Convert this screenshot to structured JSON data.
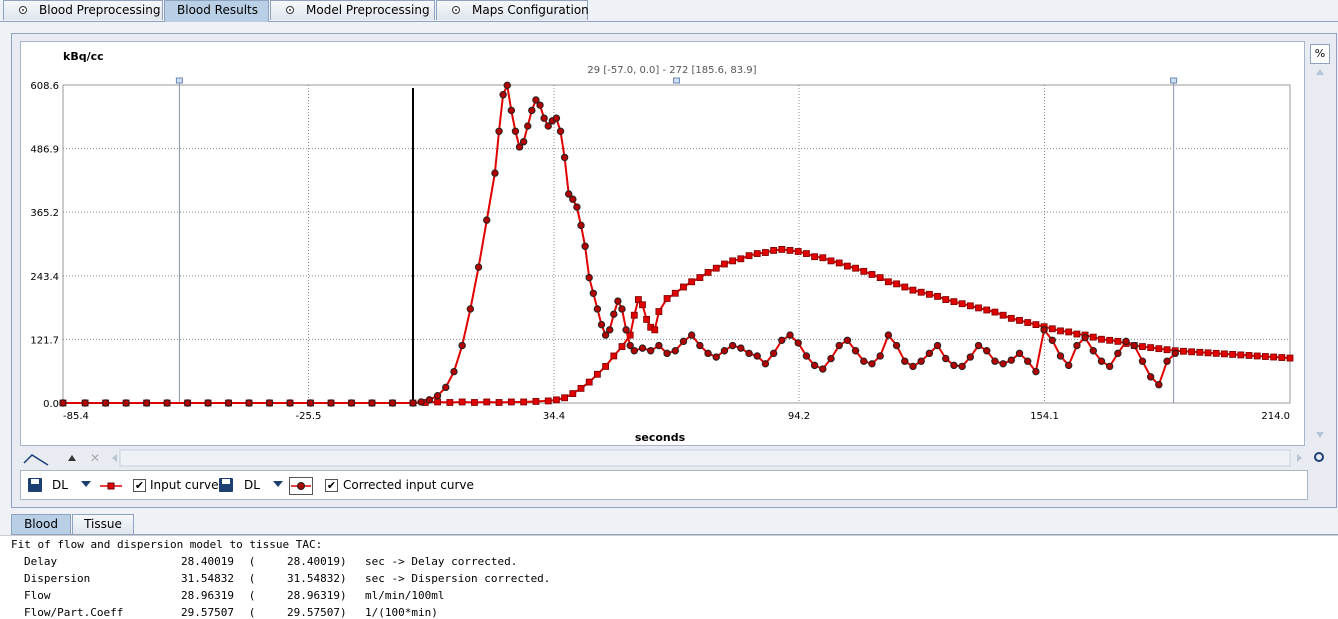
{
  "tabs": [
    {
      "label": "Blood Preprocessing",
      "active": false
    },
    {
      "label": "Blood Results",
      "active": true
    },
    {
      "label": "Model Preprocessing",
      "active": false
    },
    {
      "label": "Maps Configuration",
      "active": false
    }
  ],
  "plot": {
    "y_unit": "kBq/cc",
    "x_label": "seconds",
    "range_readout": "29 [-57.0, 0.0] - 272 [185.6, 83.9]",
    "percent_button": "%"
  },
  "chart_data": {
    "type": "line",
    "xlabel": "seconds",
    "ylabel": "kBq/cc",
    "xlim": [
      -85.4,
      214.0
    ],
    "ylim": [
      0.0,
      608.6
    ],
    "x_ticks": [
      "-85.4",
      "-25.5",
      "34.4",
      "94.2",
      "154.1",
      "214.0"
    ],
    "y_ticks": [
      "608.6",
      "486.9",
      "365.2",
      "243.4",
      "121.7",
      "0.0"
    ],
    "grid": true,
    "markers_x": [
      -57.0,
      185.6
    ],
    "delay_line_x": 0.0,
    "series": [
      {
        "name": "Input curve",
        "color": "#e00000",
        "marker": "square",
        "points": [
          [
            -85.4,
            0
          ],
          [
            -80,
            0
          ],
          [
            -75,
            0
          ],
          [
            -70,
            0
          ],
          [
            -65,
            0
          ],
          [
            -60,
            0
          ],
          [
            -55,
            0
          ],
          [
            -50,
            0
          ],
          [
            -45,
            0
          ],
          [
            -40,
            0
          ],
          [
            -35,
            0
          ],
          [
            -30,
            0
          ],
          [
            -25,
            0
          ],
          [
            -20,
            0
          ],
          [
            -15,
            0
          ],
          [
            -10,
            0
          ],
          [
            -5,
            0
          ],
          [
            0,
            0
          ],
          [
            3,
            1
          ],
          [
            6,
            2
          ],
          [
            9,
            1
          ],
          [
            12,
            2
          ],
          [
            15,
            1
          ],
          [
            18,
            2
          ],
          [
            21,
            1
          ],
          [
            24,
            2
          ],
          [
            27,
            2
          ],
          [
            30,
            3
          ],
          [
            33,
            4
          ],
          [
            35,
            6
          ],
          [
            37,
            10
          ],
          [
            39,
            18
          ],
          [
            41,
            28
          ],
          [
            43,
            40
          ],
          [
            45,
            55
          ],
          [
            47,
            70
          ],
          [
            49,
            90
          ],
          [
            51,
            108
          ],
          [
            53,
            130
          ],
          [
            54,
            168
          ],
          [
            55,
            198
          ],
          [
            56,
            188
          ],
          [
            57,
            160
          ],
          [
            58,
            145
          ],
          [
            59,
            140
          ],
          [
            60,
            175
          ],
          [
            62,
            200
          ],
          [
            64,
            210
          ],
          [
            66,
            222
          ],
          [
            68,
            232
          ],
          [
            70,
            240
          ],
          [
            72,
            250
          ],
          [
            74,
            258
          ],
          [
            76,
            266
          ],
          [
            78,
            272
          ],
          [
            80,
            276
          ],
          [
            82,
            282
          ],
          [
            84,
            286
          ],
          [
            86,
            288
          ],
          [
            88,
            292
          ],
          [
            90,
            294
          ],
          [
            92,
            292
          ],
          [
            94,
            290
          ],
          [
            96,
            286
          ],
          [
            98,
            280
          ],
          [
            100,
            278
          ],
          [
            102,
            272
          ],
          [
            104,
            268
          ],
          [
            106,
            262
          ],
          [
            108,
            258
          ],
          [
            110,
            252
          ],
          [
            112,
            246
          ],
          [
            114,
            240
          ],
          [
            116,
            232
          ],
          [
            118,
            228
          ],
          [
            120,
            222
          ],
          [
            122,
            216
          ],
          [
            124,
            212
          ],
          [
            126,
            208
          ],
          [
            128,
            204
          ],
          [
            130,
            198
          ],
          [
            132,
            194
          ],
          [
            134,
            190
          ],
          [
            136,
            186
          ],
          [
            138,
            182
          ],
          [
            140,
            178
          ],
          [
            142,
            174
          ],
          [
            144,
            168
          ],
          [
            146,
            162
          ],
          [
            148,
            158
          ],
          [
            150,
            154
          ],
          [
            152,
            150
          ],
          [
            154,
            146
          ],
          [
            156,
            142
          ],
          [
            158,
            138
          ],
          [
            160,
            136
          ],
          [
            162,
            132
          ],
          [
            164,
            130
          ],
          [
            166,
            126
          ],
          [
            168,
            122
          ],
          [
            170,
            120
          ],
          [
            172,
            118
          ],
          [
            174,
            114
          ],
          [
            176,
            110
          ],
          [
            178,
            108
          ],
          [
            180,
            106
          ],
          [
            182,
            104
          ],
          [
            184,
            102
          ],
          [
            186,
            100
          ],
          [
            188,
            99
          ],
          [
            190,
            98
          ],
          [
            192,
            97
          ],
          [
            194,
            96
          ],
          [
            196,
            95
          ],
          [
            198,
            94
          ],
          [
            200,
            93
          ],
          [
            202,
            92
          ],
          [
            204,
            91
          ],
          [
            206,
            90
          ],
          [
            208,
            89
          ],
          [
            210,
            88
          ],
          [
            212,
            87
          ],
          [
            214,
            86
          ]
        ]
      },
      {
        "name": "Corrected input curve",
        "color": "#e00000",
        "marker": "circle",
        "points": [
          [
            -85.4,
            0
          ],
          [
            -80,
            0
          ],
          [
            -75,
            0
          ],
          [
            -70,
            0
          ],
          [
            -65,
            0
          ],
          [
            -60,
            0
          ],
          [
            -55,
            0
          ],
          [
            -50,
            0
          ],
          [
            -45,
            0
          ],
          [
            -40,
            0
          ],
          [
            -35,
            0
          ],
          [
            -30,
            0
          ],
          [
            -25,
            0
          ],
          [
            -20,
            0
          ],
          [
            -15,
            0
          ],
          [
            -10,
            0
          ],
          [
            -5,
            0
          ],
          [
            0,
            0
          ],
          [
            2,
            2
          ],
          [
            4,
            6
          ],
          [
            6,
            14
          ],
          [
            8,
            30
          ],
          [
            10,
            60
          ],
          [
            12,
            110
          ],
          [
            14,
            180
          ],
          [
            16,
            260
          ],
          [
            18,
            350
          ],
          [
            20,
            440
          ],
          [
            21,
            520
          ],
          [
            22,
            590
          ],
          [
            23,
            608
          ],
          [
            24,
            560
          ],
          [
            25,
            520
          ],
          [
            26,
            490
          ],
          [
            27,
            500
          ],
          [
            28,
            530
          ],
          [
            29,
            560
          ],
          [
            30,
            580
          ],
          [
            31,
            570
          ],
          [
            32,
            545
          ],
          [
            33,
            530
          ],
          [
            34,
            540
          ],
          [
            35,
            545
          ],
          [
            36,
            520
          ],
          [
            37,
            470
          ],
          [
            38,
            400
          ],
          [
            39,
            390
          ],
          [
            40,
            375
          ],
          [
            41,
            340
          ],
          [
            42,
            300
          ],
          [
            43,
            240
          ],
          [
            44,
            210
          ],
          [
            45,
            180
          ],
          [
            46,
            150
          ],
          [
            47,
            130
          ],
          [
            48,
            140
          ],
          [
            49,
            170
          ],
          [
            50,
            195
          ],
          [
            51,
            180
          ],
          [
            52,
            140
          ],
          [
            53,
            110
          ],
          [
            54,
            100
          ],
          [
            56,
            105
          ],
          [
            58,
            100
          ],
          [
            60,
            110
          ],
          [
            62,
            95
          ],
          [
            64,
            100
          ],
          [
            66,
            118
          ],
          [
            68,
            130
          ],
          [
            70,
            110
          ],
          [
            72,
            95
          ],
          [
            74,
            88
          ],
          [
            76,
            100
          ],
          [
            78,
            110
          ],
          [
            80,
            105
          ],
          [
            82,
            95
          ],
          [
            84,
            90
          ],
          [
            86,
            75
          ],
          [
            88,
            95
          ],
          [
            90,
            120
          ],
          [
            92,
            130
          ],
          [
            94,
            115
          ],
          [
            96,
            90
          ],
          [
            98,
            72
          ],
          [
            100,
            65
          ],
          [
            102,
            85
          ],
          [
            104,
            110
          ],
          [
            106,
            120
          ],
          [
            108,
            100
          ],
          [
            110,
            80
          ],
          [
            112,
            75
          ],
          [
            114,
            90
          ],
          [
            116,
            130
          ],
          [
            118,
            110
          ],
          [
            120,
            80
          ],
          [
            122,
            70
          ],
          [
            124,
            80
          ],
          [
            126,
            95
          ],
          [
            128,
            110
          ],
          [
            130,
            85
          ],
          [
            132,
            72
          ],
          [
            134,
            70
          ],
          [
            136,
            88
          ],
          [
            138,
            110
          ],
          [
            140,
            100
          ],
          [
            142,
            80
          ],
          [
            144,
            75
          ],
          [
            146,
            82
          ],
          [
            148,
            95
          ],
          [
            150,
            80
          ],
          [
            152,
            60
          ],
          [
            154,
            140
          ],
          [
            156,
            120
          ],
          [
            158,
            90
          ],
          [
            160,
            72
          ],
          [
            162,
            110
          ],
          [
            164,
            125
          ],
          [
            166,
            100
          ],
          [
            168,
            80
          ],
          [
            170,
            70
          ],
          [
            172,
            95
          ],
          [
            174,
            118
          ],
          [
            176,
            110
          ],
          [
            178,
            80
          ],
          [
            180,
            50
          ],
          [
            182,
            35
          ],
          [
            184,
            80
          ],
          [
            186,
            95
          ]
        ]
      }
    ]
  },
  "legend": {
    "dl1": "DL",
    "input_label": "Input curve",
    "dl2": "DL",
    "corrected_label": "Corrected input curve"
  },
  "bottom_tabs": [
    {
      "label": "Blood",
      "active": true
    },
    {
      "label": "Tissue",
      "active": false
    }
  ],
  "results": {
    "heading": "Fit of flow and dispersion model to tissue TAC:",
    "rows": [
      {
        "name": "Delay",
        "value": "28.40019",
        "paren_value": "28.40019",
        "unit": "sec -> Delay corrected."
      },
      {
        "name": "Dispersion",
        "value": "31.54832",
        "paren_value": "31.54832",
        "unit": "sec -> Dispersion corrected."
      },
      {
        "name": "Flow",
        "value": "28.96319",
        "paren_value": "28.96319",
        "unit": "ml/min/100ml"
      },
      {
        "name": "Flow/Part.Coeff",
        "value": "29.57507",
        "paren_value": "29.57507",
        "unit": "1/(100*min)"
      }
    ]
  }
}
